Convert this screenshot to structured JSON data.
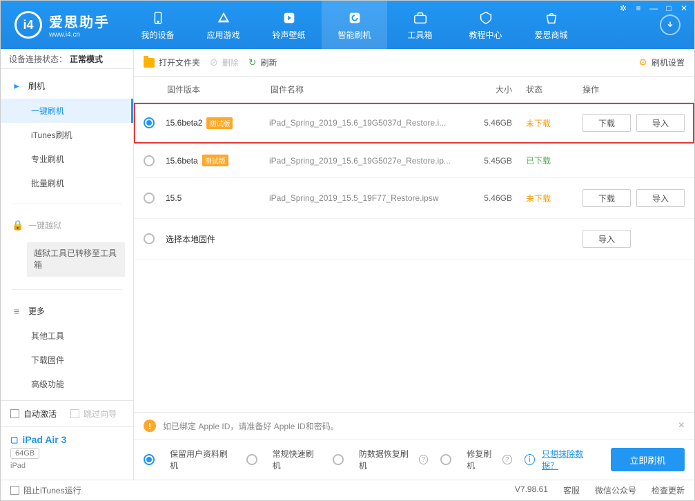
{
  "app": {
    "title": "爱思助手",
    "url": "www.i4.cn"
  },
  "nav": [
    {
      "label": "我的设备"
    },
    {
      "label": "应用游戏"
    },
    {
      "label": "铃声壁纸"
    },
    {
      "label": "智能刷机",
      "active": true
    },
    {
      "label": "工具箱"
    },
    {
      "label": "教程中心"
    },
    {
      "label": "爱思商城"
    }
  ],
  "connection": {
    "label": "设备连接状态：",
    "value": "正常模式"
  },
  "sidebar": {
    "flash": {
      "title": "刷机",
      "items": [
        "一键刷机",
        "iTunes刷机",
        "专业刷机",
        "批量刷机"
      ]
    },
    "jailbreak": {
      "title": "一键越狱",
      "note": "越狱工具已转移至工具箱"
    },
    "more": {
      "title": "更多",
      "items": [
        "其他工具",
        "下载固件",
        "高级功能"
      ]
    },
    "checks": {
      "auto_activate": "自动激活",
      "skip_wizard": "跳过向导"
    },
    "device": {
      "name": "iPad Air 3",
      "storage": "64GB",
      "type": "iPad"
    }
  },
  "toolbar": {
    "open_folder": "打开文件夹",
    "delete": "删除",
    "refresh": "刷新",
    "settings": "刷机设置"
  },
  "table": {
    "head": {
      "version": "固件版本",
      "name": "固件名称",
      "size": "大小",
      "status": "状态",
      "ops": "操作"
    },
    "rows": [
      {
        "selected": true,
        "highlighted": true,
        "version": "15.6beta2",
        "beta": "测试版",
        "name": "iPad_Spring_2019_15.6_19G5037d_Restore.i...",
        "size": "5.46GB",
        "status": "未下载",
        "status_class": "notdl",
        "ops": [
          "下载",
          "导入"
        ]
      },
      {
        "selected": false,
        "version": "15.6beta",
        "beta": "测试版",
        "name": "iPad_Spring_2019_15.6_19G5027e_Restore.ip...",
        "size": "5.45GB",
        "status": "已下载",
        "status_class": "dl",
        "ops": []
      },
      {
        "selected": false,
        "version": "15.5",
        "name": "iPad_Spring_2019_15.5_19F77_Restore.ipsw",
        "size": "5.46GB",
        "status": "未下载",
        "status_class": "notdl",
        "ops": [
          "下载",
          "导入"
        ]
      },
      {
        "selected": false,
        "version": "选择本地固件",
        "local": true,
        "ops_import_only": "导入"
      }
    ]
  },
  "warning": "如已绑定 Apple ID，请准备好 Apple ID和密码。",
  "options": {
    "keep_data": "保留用户资料刷机",
    "quick": "常规快速刷机",
    "recovery": "防数据恢复刷机",
    "repair": "修复刷机",
    "erase_link": "只想抹除数据？",
    "start": "立即刷机"
  },
  "statusbar": {
    "block_itunes": "阻止iTunes运行",
    "version": "V7.98.61",
    "links": [
      "客服",
      "微信公众号",
      "检查更新"
    ]
  }
}
